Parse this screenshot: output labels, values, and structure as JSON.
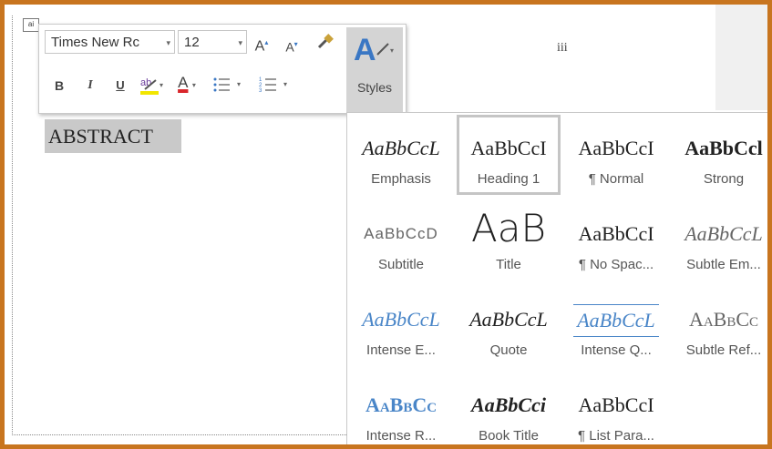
{
  "document": {
    "page_number": "iii",
    "heading_text": "ABSTRACT"
  },
  "mini_toolbar": {
    "font_name": "Times New Rc",
    "font_size": "12",
    "grow_font": "A",
    "shrink_font": "A",
    "bold": "B",
    "italic": "I",
    "underline": "U",
    "font_color": "A",
    "styles_label": "Styles"
  },
  "styles_gallery": {
    "items": [
      {
        "preview": "AaBbCcL",
        "label": "Emphasis"
      },
      {
        "preview": "AaBbCcI",
        "label": "Heading 1",
        "selected": true
      },
      {
        "preview": "AaBbCcI",
        "label": "¶ Normal"
      },
      {
        "preview": "AaBbCcl",
        "label": "Strong"
      },
      {
        "preview": "AaBbCcD",
        "label": "Subtitle"
      },
      {
        "preview": "AaB",
        "label": "Title"
      },
      {
        "preview": "AaBbCcI",
        "label": "¶ No Spac..."
      },
      {
        "preview": "AaBbCcL",
        "label": "Subtle Em..."
      },
      {
        "preview": "AaBbCcL",
        "label": "Intense E..."
      },
      {
        "preview": "AaBbCcL",
        "label": "Quote"
      },
      {
        "preview": "AaBbCcL",
        "label": "Intense Q..."
      },
      {
        "preview": "AaBbCc",
        "label": "Subtle Ref..."
      },
      {
        "preview": "AaBbCc",
        "label": "Intense R..."
      },
      {
        "preview": "AaBbCci",
        "label": "Book Title"
      },
      {
        "preview": "AaBbCcI",
        "label": "¶ List Para..."
      }
    ]
  },
  "colors": {
    "frame_border": "#c8751f",
    "accent_blue": "#3a77c4",
    "font_color_red": "#d9262b",
    "highlight_yellow": "#f2e600"
  }
}
